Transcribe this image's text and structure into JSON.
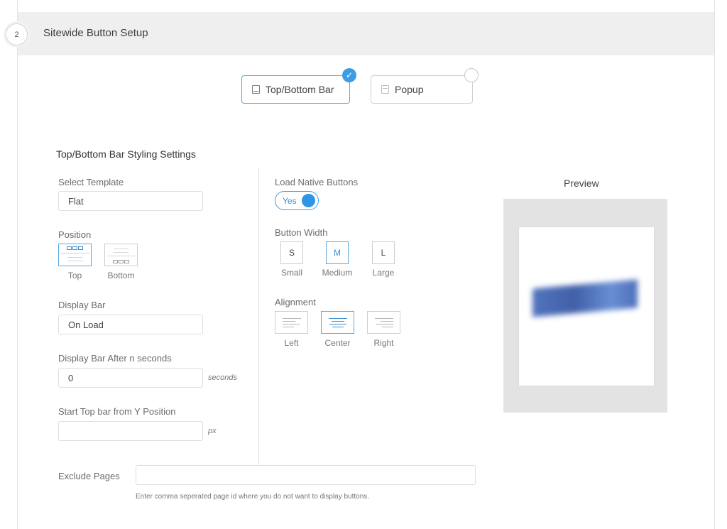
{
  "header": {
    "step_number": "2",
    "title": "Sitewide Button Setup"
  },
  "display_types": [
    {
      "label": "Top/Bottom Bar",
      "selected": true,
      "icon": "bar-layout-icon"
    },
    {
      "label": "Popup",
      "selected": false,
      "icon": "popup-layout-icon"
    }
  ],
  "styling": {
    "section_title": "Top/Bottom Bar Styling Settings",
    "template": {
      "label": "Select Template",
      "value": "Flat"
    },
    "position": {
      "label": "Position",
      "options": [
        "Top",
        "Bottom"
      ],
      "selected": "Top"
    },
    "display_bar": {
      "label": "Display Bar",
      "value": "On Load"
    },
    "delay": {
      "label": "Display Bar After n seconds",
      "value": "0",
      "unit": "seconds"
    },
    "start_y": {
      "label": "Start Top bar from Y Position",
      "value": "",
      "unit": "px"
    },
    "native_buttons": {
      "label": "Load Native Buttons",
      "value": "Yes",
      "enabled": true
    },
    "button_width": {
      "label": "Button Width",
      "options": [
        {
          "short": "S",
          "name": "Small"
        },
        {
          "short": "M",
          "name": "Medium"
        },
        {
          "short": "L",
          "name": "Large"
        }
      ],
      "selected": "M"
    },
    "alignment": {
      "label": "Alignment",
      "options": [
        "Left",
        "Center",
        "Right"
      ],
      "selected": "Center"
    },
    "exclude_pages": {
      "label": "Exclude Pages",
      "value": "",
      "hint": "Enter comma seperated page id where you do not want to display buttons."
    }
  },
  "preview": {
    "title": "Preview"
  },
  "colors": {
    "accent": "#3d9de3",
    "header_bg": "#efefef",
    "preview_bar": "#3f66b8"
  }
}
